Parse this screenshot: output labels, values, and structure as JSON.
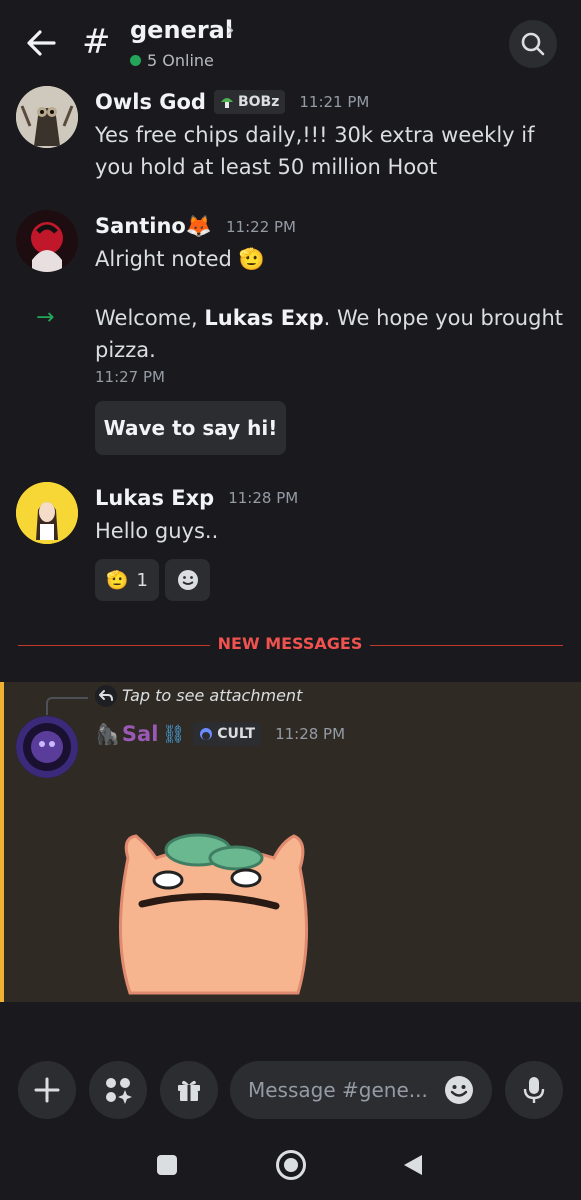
{
  "header": {
    "channel": "general",
    "online": "5 Online"
  },
  "messages": [
    {
      "author": "Owls God",
      "tag": "BOBz",
      "time": "11:21 PM",
      "text": "Yes free chips daily,!!! 30k extra weekly if you hold at least 50 million Hoot"
    },
    {
      "author": "Santino🦊",
      "time": "11:22 PM",
      "text": "Alright noted 🫡"
    },
    {
      "welcome_prefix": "Welcome, ",
      "welcome_name": "Lukas Exp",
      "welcome_suffix": ". We hope you brought pizza.",
      "time": "11:27 PM",
      "wave_label": "Wave to say hi!"
    },
    {
      "author": "Lukas Exp",
      "time": "11:28 PM",
      "text": "Hello guys..",
      "reaction_emoji": "🫡",
      "reaction_count": "1"
    }
  ],
  "new_messages_label": "NEW MESSAGES",
  "reply": {
    "text": "Tap to see attachment"
  },
  "sal_message": {
    "author_prefix": "🦍",
    "author": "Sal",
    "author_suffix": "⛓",
    "tag": "CULT",
    "time": "11:28 PM"
  },
  "composer": {
    "placeholder": "Message #gene..."
  },
  "colors": {
    "accent_green": "#23a55a",
    "new_messages_red": "#f0524f",
    "highlight_bar": "#f0b232",
    "sal_name": "#9b59b6"
  }
}
